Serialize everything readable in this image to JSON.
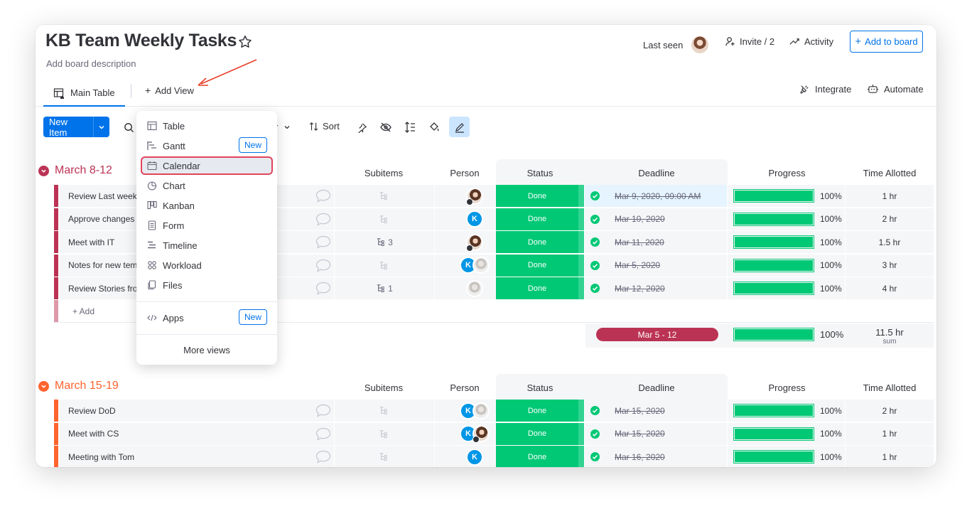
{
  "board": {
    "title": "KB Team Weekly Tasks",
    "description": "Add board description",
    "last_seen": "Last seen",
    "invite": "Invite / 2",
    "activity": "Activity",
    "add_to_board": "Add to board"
  },
  "tabs": {
    "main_table": "Main Table",
    "add_view": "Add View",
    "integrate": "Integrate",
    "automate": "Automate"
  },
  "toolbar": {
    "new_item": "New Item",
    "sort": "Sort",
    "filter_partial": "r"
  },
  "columns": {
    "subitems": "Subitems",
    "person": "Person",
    "status": "Status",
    "deadline": "Deadline",
    "progress": "Progress",
    "time": "Time Allotted"
  },
  "groups": [
    {
      "title": "March 8-12",
      "color": "#bb3354",
      "add_label": "+ Add",
      "summary": {
        "deadline": "Mar 5 - 12",
        "progress": "100%",
        "time": "11.5 hr",
        "time_sub": "sum"
      },
      "rows": [
        {
          "name": "Review Last week's",
          "subitems": "",
          "status": "Done",
          "deadline": "Mar 9, 2020, 09:00 AM",
          "progress": "100%",
          "progress_value": 100,
          "time": "1 hr"
        },
        {
          "name": "Approve changes t",
          "subitems": "",
          "status": "Done",
          "deadline": "Mar 10, 2020",
          "progress": "100%",
          "progress_value": 100,
          "time": "2 hr"
        },
        {
          "name": "Meet with IT",
          "subitems": "3",
          "status": "Done",
          "deadline": "Mar 11, 2020",
          "progress": "100%",
          "progress_value": 100,
          "time": "1.5 hr"
        },
        {
          "name": "Notes for new tem",
          "subitems": "",
          "status": "Done",
          "deadline": "Mar 5, 2020",
          "progress": "100%",
          "progress_value": 100,
          "time": "3 hr"
        },
        {
          "name": "Review Stories fron",
          "subitems": "1",
          "status": "Done",
          "deadline": "Mar 12, 2020",
          "progress": "100%",
          "progress_value": 100,
          "time": "4 hr"
        }
      ]
    },
    {
      "title": "March 15-19",
      "color": "#ff642e",
      "rows": [
        {
          "name": "Review DoD",
          "subitems": "",
          "status": "Done",
          "deadline": "Mar 15, 2020",
          "progress": "100%",
          "progress_value": 100,
          "time": "2 hr"
        },
        {
          "name": "Meet with CS",
          "subitems": "",
          "status": "Done",
          "deadline": "Mar 15, 2020",
          "progress": "100%",
          "progress_value": 100,
          "time": "1 hr"
        },
        {
          "name": "Meeting with Tom",
          "subitems": "",
          "status": "Done",
          "deadline": "Mar 16, 2020",
          "progress": "100%",
          "progress_value": 100,
          "time": "1 hr"
        }
      ]
    }
  ],
  "avatar_initial": "K",
  "dropdown": {
    "items": [
      "Table",
      "Gantt",
      "Calendar",
      "Chart",
      "Kanban",
      "Form",
      "Timeline",
      "Workload",
      "Files"
    ],
    "new_badge": "New",
    "apps": "Apps",
    "more_views": "More views",
    "selected": "Calendar"
  },
  "colors": {
    "accent": "#0073ea",
    "done": "#00c875",
    "group1": "#bb3354",
    "group2": "#ff642e",
    "highlight": "#e2445c"
  }
}
